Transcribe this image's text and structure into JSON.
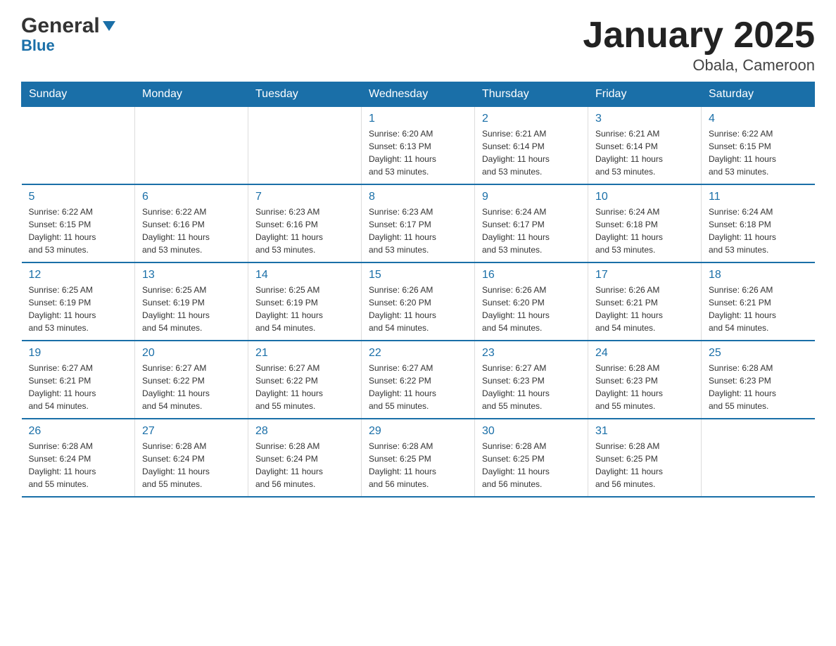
{
  "header": {
    "logo_general": "General",
    "logo_blue": "Blue",
    "title": "January 2025",
    "subtitle": "Obala, Cameroon"
  },
  "days_of_week": [
    "Sunday",
    "Monday",
    "Tuesday",
    "Wednesday",
    "Thursday",
    "Friday",
    "Saturday"
  ],
  "weeks": [
    {
      "cells": [
        {
          "day": "",
          "info": ""
        },
        {
          "day": "",
          "info": ""
        },
        {
          "day": "",
          "info": ""
        },
        {
          "day": "1",
          "info": "Sunrise: 6:20 AM\nSunset: 6:13 PM\nDaylight: 11 hours\nand 53 minutes."
        },
        {
          "day": "2",
          "info": "Sunrise: 6:21 AM\nSunset: 6:14 PM\nDaylight: 11 hours\nand 53 minutes."
        },
        {
          "day": "3",
          "info": "Sunrise: 6:21 AM\nSunset: 6:14 PM\nDaylight: 11 hours\nand 53 minutes."
        },
        {
          "day": "4",
          "info": "Sunrise: 6:22 AM\nSunset: 6:15 PM\nDaylight: 11 hours\nand 53 minutes."
        }
      ]
    },
    {
      "cells": [
        {
          "day": "5",
          "info": "Sunrise: 6:22 AM\nSunset: 6:15 PM\nDaylight: 11 hours\nand 53 minutes."
        },
        {
          "day": "6",
          "info": "Sunrise: 6:22 AM\nSunset: 6:16 PM\nDaylight: 11 hours\nand 53 minutes."
        },
        {
          "day": "7",
          "info": "Sunrise: 6:23 AM\nSunset: 6:16 PM\nDaylight: 11 hours\nand 53 minutes."
        },
        {
          "day": "8",
          "info": "Sunrise: 6:23 AM\nSunset: 6:17 PM\nDaylight: 11 hours\nand 53 minutes."
        },
        {
          "day": "9",
          "info": "Sunrise: 6:24 AM\nSunset: 6:17 PM\nDaylight: 11 hours\nand 53 minutes."
        },
        {
          "day": "10",
          "info": "Sunrise: 6:24 AM\nSunset: 6:18 PM\nDaylight: 11 hours\nand 53 minutes."
        },
        {
          "day": "11",
          "info": "Sunrise: 6:24 AM\nSunset: 6:18 PM\nDaylight: 11 hours\nand 53 minutes."
        }
      ]
    },
    {
      "cells": [
        {
          "day": "12",
          "info": "Sunrise: 6:25 AM\nSunset: 6:19 PM\nDaylight: 11 hours\nand 53 minutes."
        },
        {
          "day": "13",
          "info": "Sunrise: 6:25 AM\nSunset: 6:19 PM\nDaylight: 11 hours\nand 54 minutes."
        },
        {
          "day": "14",
          "info": "Sunrise: 6:25 AM\nSunset: 6:19 PM\nDaylight: 11 hours\nand 54 minutes."
        },
        {
          "day": "15",
          "info": "Sunrise: 6:26 AM\nSunset: 6:20 PM\nDaylight: 11 hours\nand 54 minutes."
        },
        {
          "day": "16",
          "info": "Sunrise: 6:26 AM\nSunset: 6:20 PM\nDaylight: 11 hours\nand 54 minutes."
        },
        {
          "day": "17",
          "info": "Sunrise: 6:26 AM\nSunset: 6:21 PM\nDaylight: 11 hours\nand 54 minutes."
        },
        {
          "day": "18",
          "info": "Sunrise: 6:26 AM\nSunset: 6:21 PM\nDaylight: 11 hours\nand 54 minutes."
        }
      ]
    },
    {
      "cells": [
        {
          "day": "19",
          "info": "Sunrise: 6:27 AM\nSunset: 6:21 PM\nDaylight: 11 hours\nand 54 minutes."
        },
        {
          "day": "20",
          "info": "Sunrise: 6:27 AM\nSunset: 6:22 PM\nDaylight: 11 hours\nand 54 minutes."
        },
        {
          "day": "21",
          "info": "Sunrise: 6:27 AM\nSunset: 6:22 PM\nDaylight: 11 hours\nand 55 minutes."
        },
        {
          "day": "22",
          "info": "Sunrise: 6:27 AM\nSunset: 6:22 PM\nDaylight: 11 hours\nand 55 minutes."
        },
        {
          "day": "23",
          "info": "Sunrise: 6:27 AM\nSunset: 6:23 PM\nDaylight: 11 hours\nand 55 minutes."
        },
        {
          "day": "24",
          "info": "Sunrise: 6:28 AM\nSunset: 6:23 PM\nDaylight: 11 hours\nand 55 minutes."
        },
        {
          "day": "25",
          "info": "Sunrise: 6:28 AM\nSunset: 6:23 PM\nDaylight: 11 hours\nand 55 minutes."
        }
      ]
    },
    {
      "cells": [
        {
          "day": "26",
          "info": "Sunrise: 6:28 AM\nSunset: 6:24 PM\nDaylight: 11 hours\nand 55 minutes."
        },
        {
          "day": "27",
          "info": "Sunrise: 6:28 AM\nSunset: 6:24 PM\nDaylight: 11 hours\nand 55 minutes."
        },
        {
          "day": "28",
          "info": "Sunrise: 6:28 AM\nSunset: 6:24 PM\nDaylight: 11 hours\nand 56 minutes."
        },
        {
          "day": "29",
          "info": "Sunrise: 6:28 AM\nSunset: 6:25 PM\nDaylight: 11 hours\nand 56 minutes."
        },
        {
          "day": "30",
          "info": "Sunrise: 6:28 AM\nSunset: 6:25 PM\nDaylight: 11 hours\nand 56 minutes."
        },
        {
          "day": "31",
          "info": "Sunrise: 6:28 AM\nSunset: 6:25 PM\nDaylight: 11 hours\nand 56 minutes."
        },
        {
          "day": "",
          "info": ""
        }
      ]
    }
  ]
}
